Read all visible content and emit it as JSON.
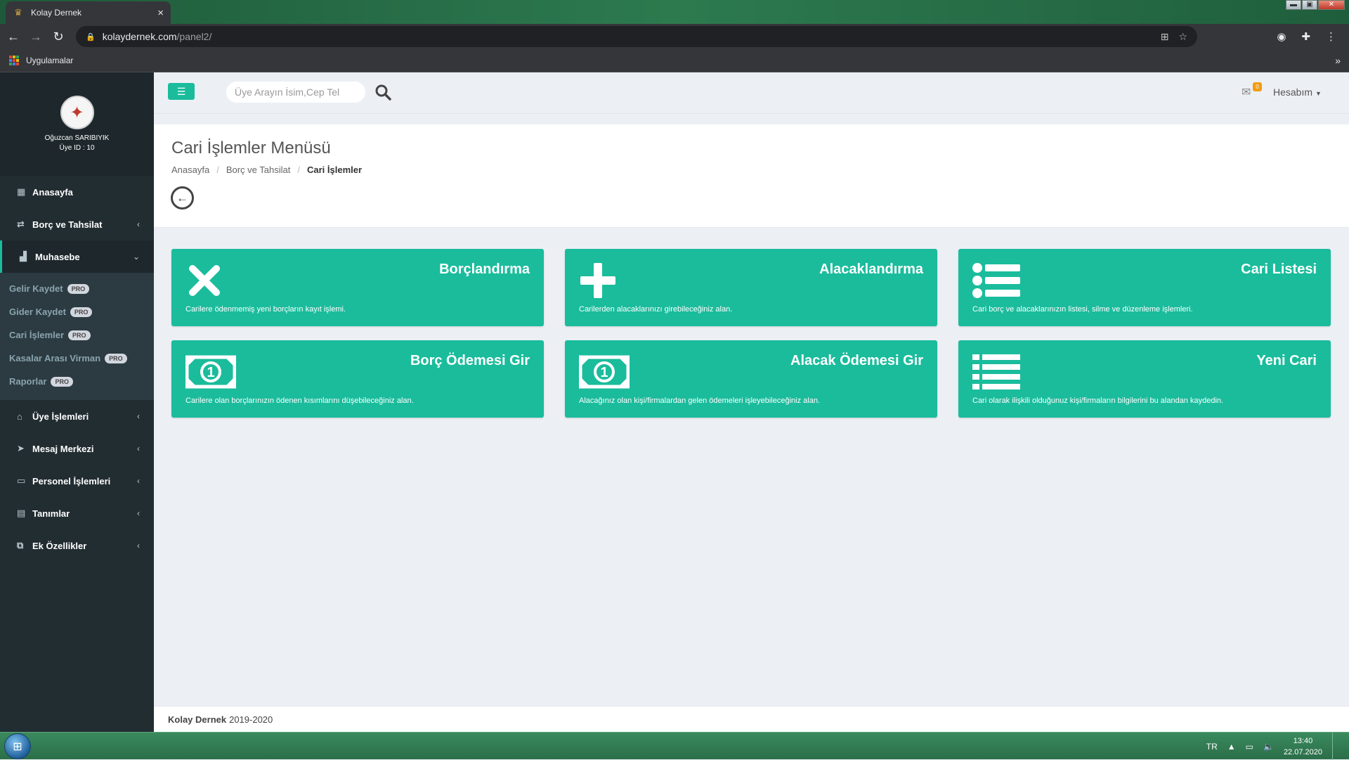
{
  "browser": {
    "tab_title": "Kolay Dernek",
    "tab_close": "×",
    "url_host": "kolaydernek.com",
    "url_path": "/panel2/",
    "bookmarks_apps": "Uygulamalar",
    "bookmarks_more": "»",
    "win_min": "▬",
    "win_max": "▣",
    "win_close": "✕"
  },
  "user": {
    "name": "Oğuzcan SARIBIYIK",
    "id_label": "Üye ID : 10"
  },
  "sidebar": {
    "items": [
      {
        "label": "Anasayfa",
        "icon": "dashboard-icon",
        "glyph": "▦"
      },
      {
        "label": "Borç ve Tahsilat",
        "icon": "exchange-icon",
        "glyph": "⇄"
      },
      {
        "label": "Muhasebe",
        "icon": "chart-icon",
        "glyph": "▟"
      }
    ],
    "sub_items": [
      {
        "label": "Gelir Kaydet",
        "badge": "PRO"
      },
      {
        "label": "Gider Kaydet",
        "badge": "PRO"
      },
      {
        "label": "Cari İşlemler",
        "badge": "PRO"
      },
      {
        "label": "Kasalar Arası Virman",
        "badge": "PRO"
      },
      {
        "label": "Raporlar",
        "badge": "PRO"
      }
    ],
    "bottom_items": [
      {
        "label": "Üye İşlemleri",
        "icon": "home-icon",
        "glyph": "⌂"
      },
      {
        "label": "Mesaj Merkezi",
        "icon": "send-icon",
        "glyph": "➤"
      },
      {
        "label": "Personel İşlemleri",
        "icon": "monitor-icon",
        "glyph": "▭"
      },
      {
        "label": "Tanımlar",
        "icon": "book-icon",
        "glyph": "▤"
      },
      {
        "label": "Ek Özellikler",
        "icon": "clone-icon",
        "glyph": "⧉"
      }
    ],
    "chevron_left": "‹",
    "chevron_down": "⌄"
  },
  "topbar": {
    "search_placeholder": "Üye Arayın İsim,Cep Tel",
    "mail_badge": "0",
    "account": "Hesabım"
  },
  "header": {
    "title": "Cari İşlemler Menüsü",
    "breadcrumb": [
      "Anasayfa",
      "Borç ve Tahsilat",
      "Cari İşlemler"
    ],
    "breadcrumb_sep": "/"
  },
  "tiles": [
    {
      "title": "Borçlandırma",
      "desc": "Carilere ödenmemiş yeni borçların kayıt işlemi.",
      "icon": "times-icon"
    },
    {
      "title": "Alacaklandırma",
      "desc": "Carilerden alacaklarınızı girebileceğiniz alan.",
      "icon": "plus-icon"
    },
    {
      "title": "Cari Listesi",
      "desc": "Cari borç ve alacaklarınızın listesi, silme ve düzenleme işlemleri.",
      "icon": "list-icon"
    },
    {
      "title": "Borç Ödemesi Gir",
      "desc": "Carilere olan borçlarınızın ödenen kısımlarını düşebileceğiniz alan.",
      "icon": "money-icon"
    },
    {
      "title": "Alacak Ödemesi Gir",
      "desc": "Alacağınız olan kişi/firmalardan gelen ödemeleri işleyebileceğiniz alan.",
      "icon": "money-icon"
    },
    {
      "title": "Yeni Cari",
      "desc": "Cari olarak ilişkili olduğunuz kişi/firmaların bilgilerini bu alandan kaydedin.",
      "icon": "list-ul-icon"
    }
  ],
  "footer": {
    "brand": "Kolay Dernek",
    "years": "2019-2020"
  },
  "taskbar": {
    "lang": "TR",
    "time": "13:40",
    "date": "22.07.2020"
  },
  "colors": {
    "accent": "#1abc9c",
    "sidebar_bg": "#222d32",
    "badge": "#f39c12"
  }
}
